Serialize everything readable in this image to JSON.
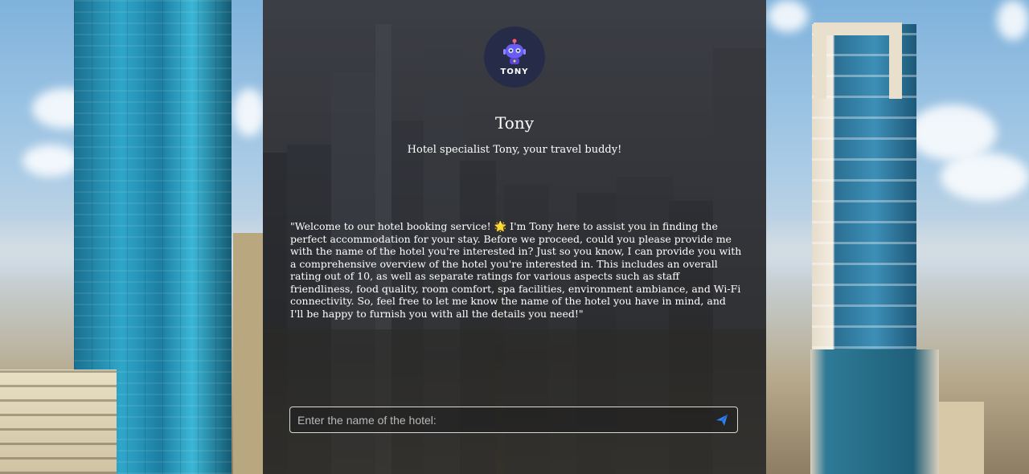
{
  "assistant": {
    "avatar_label": "TONY",
    "name": "Tony",
    "tagline": "Hotel specialist Tony, your travel buddy!"
  },
  "chat": {
    "welcome_message": "\"Welcome to our hotel booking service! 🌟 I'm Tony here to assist you in finding the perfect accommodation for your stay. Before we proceed, could you please provide me with the name of the hotel you're interested in? Just so you know, I can provide you with a comprehensive overview of the hotel you're interested in. This includes an overall rating out of 10, as well as separate ratings for various aspects such as staff friendliness, food quality, room comfort, spa facilities, environment ambiance, and Wi-Fi connectivity. So, feel free to let me know the name of the hotel you have in mind, and I'll be happy to furnish you with all the details you need!\""
  },
  "input": {
    "placeholder": "Enter the name of the hotel:",
    "value": ""
  },
  "icons": {
    "avatar": "robot-icon",
    "send": "send-icon"
  },
  "colors": {
    "avatar_bg": "#262c47",
    "robot_primary": "#6a5cf0",
    "send_accent": "#2f80ed"
  }
}
